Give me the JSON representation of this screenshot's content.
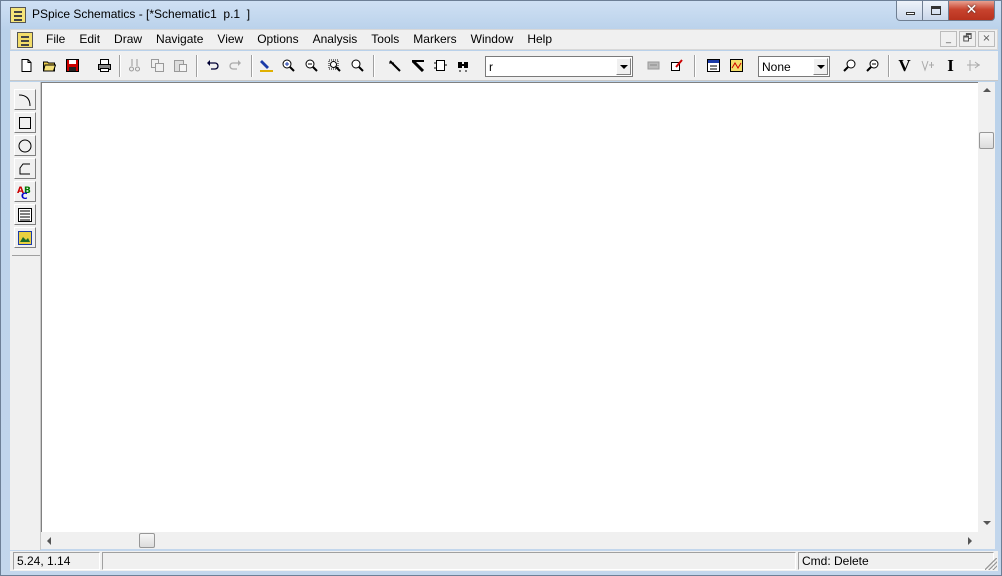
{
  "window": {
    "title": "PSpice Schematics - [*Schematic1  p.1  ]",
    "close_glyph": "✕"
  },
  "menu": {
    "items": [
      "File",
      "Edit",
      "Draw",
      "Navigate",
      "View",
      "Options",
      "Analysis",
      "Tools",
      "Markers",
      "Window",
      "Help"
    ],
    "mdi_buttons": [
      "_",
      "🗗",
      "×"
    ]
  },
  "toolbar": {
    "part_combo_value": "r",
    "marker_combo_value": "None",
    "voltage_label": "V",
    "current_label": "I",
    "icons": [
      "new-file-icon",
      "open-folder-icon",
      "save-disk-icon",
      "print-icon",
      "cut-icon",
      "copy-icon",
      "paste-icon",
      "undo-icon",
      "redo-icon",
      "redraw-icon",
      "zoom-in-icon",
      "zoom-out-icon",
      "zoom-area-icon",
      "zoom-fit-icon",
      "draw-wire-icon",
      "draw-bus-icon",
      "draw-block-icon",
      "get-part-icon",
      "edit-attributes-icon",
      "edit-symbol-icon",
      "setup-analysis-icon",
      "simulate-icon",
      "probe-voltage-icon",
      "probe-current-icon"
    ]
  },
  "palette": {
    "icons": [
      "arc-icon",
      "box-icon",
      "circle-icon",
      "polyline-icon",
      "text-icon",
      "text-box-icon",
      "insert-picture-icon"
    ]
  },
  "status": {
    "coordinates": "5.24,  1.14",
    "middle": "",
    "command": "Cmd: Delete"
  },
  "colors": {
    "accent": "#c8432e",
    "title_gradient_top": "#cfe0f4"
  }
}
